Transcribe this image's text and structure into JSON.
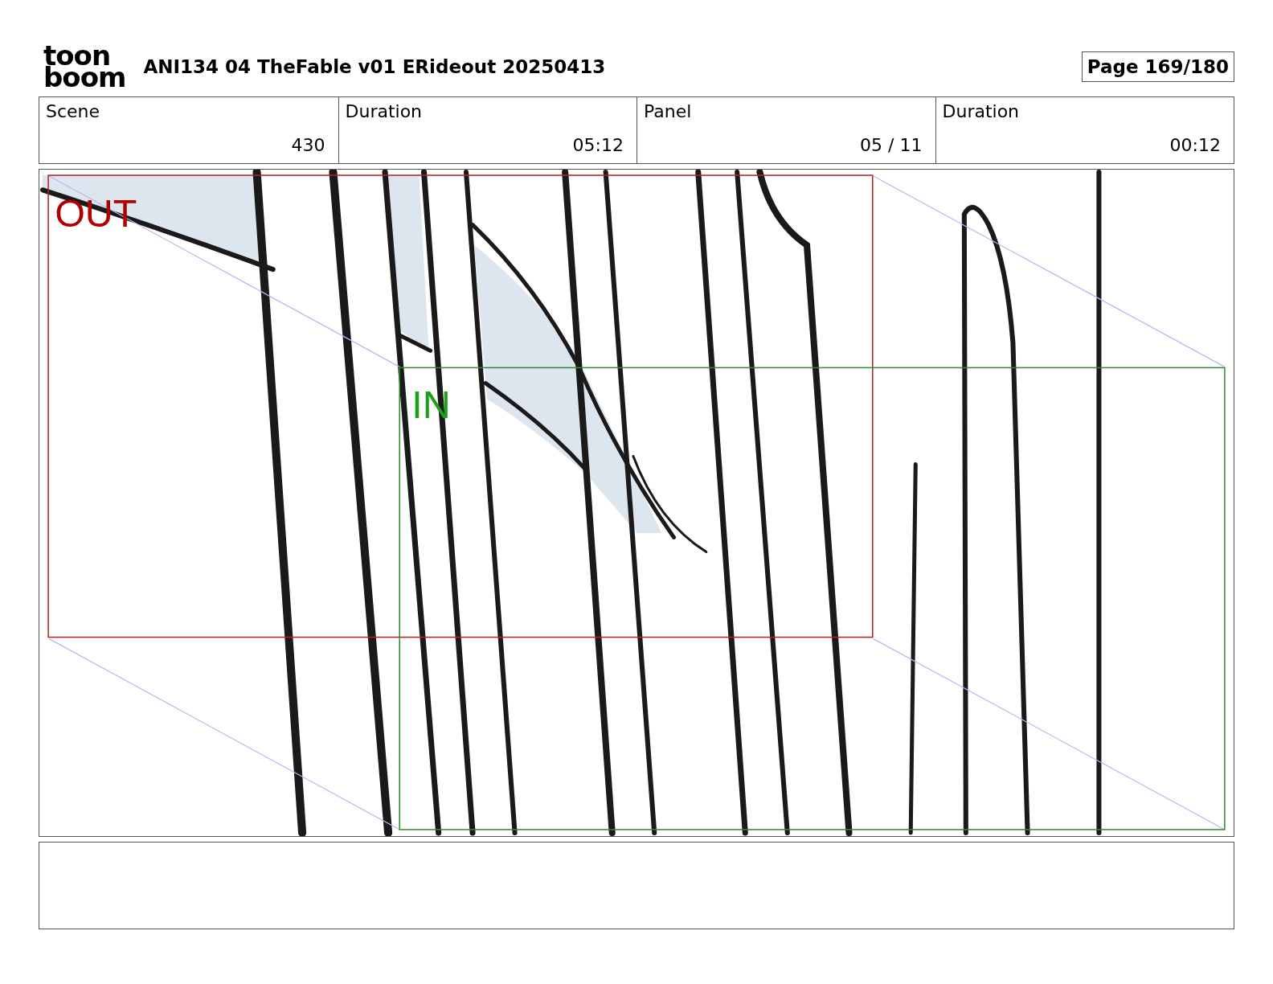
{
  "logo": {
    "line_1": "toon",
    "line_2": "boom"
  },
  "title": "ANI134 04 TheFable v01 ERideout 20250413",
  "page": "Page 169/180",
  "info": [
    {
      "label": "Scene",
      "value": "430"
    },
    {
      "label": "Duration",
      "value": "05:12"
    },
    {
      "label": "Panel",
      "value": "05 / 11"
    },
    {
      "label": "Duration",
      "value": "00:12"
    }
  ],
  "frame": {
    "out_label": "OUT",
    "in_label": "IN"
  }
}
